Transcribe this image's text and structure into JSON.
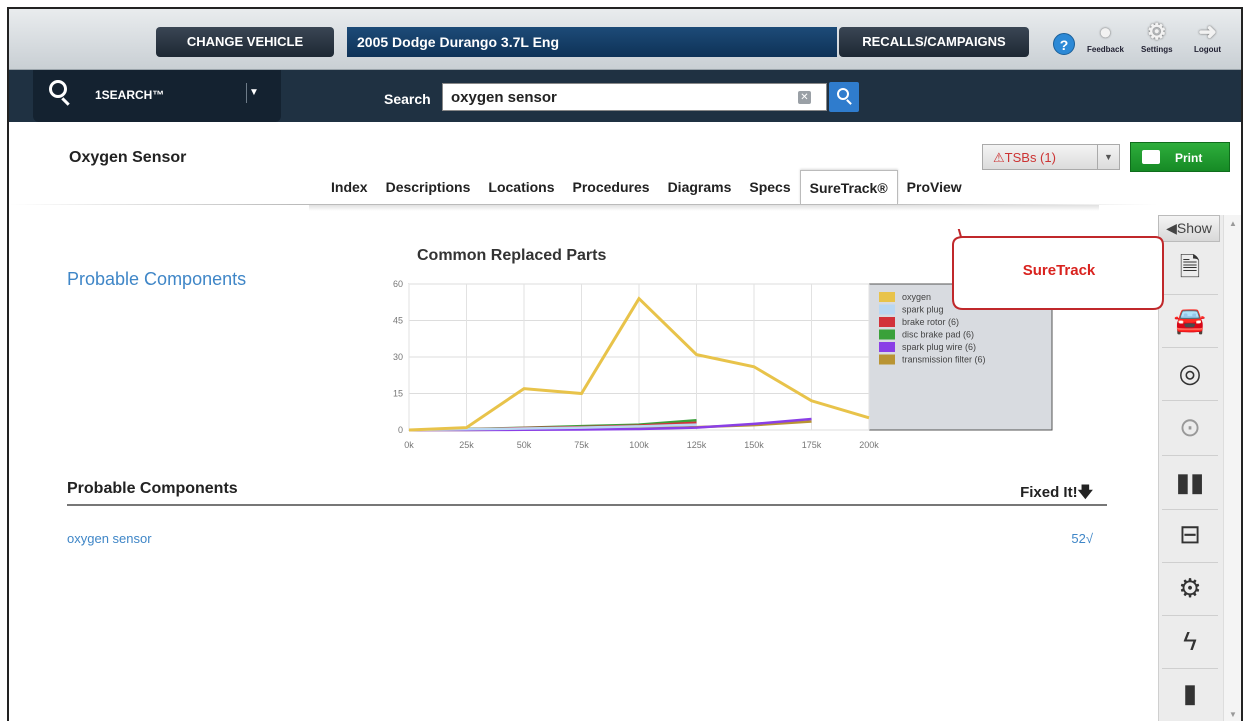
{
  "header": {
    "change_vehicle": "CHANGE VEHICLE",
    "vehicle": "2005 Dodge Durango 3.7L Eng",
    "recalls": "RECALLS/CAMPAIGNS",
    "help": "?",
    "feedback": "Feedback",
    "settings": "Settings",
    "logout": "Logout"
  },
  "search": {
    "brand": "1SEARCH™",
    "label": "Search",
    "value": "oxygen sensor",
    "clear": "✕"
  },
  "page": {
    "title": "Oxygen Sensor",
    "tsbs": "TSBs (1)",
    "print": "Print",
    "tabs": [
      "Index",
      "Descriptions",
      "Locations",
      "Procedures",
      "Diagrams",
      "Specs",
      "SureTrack®",
      "ProView"
    ],
    "active_tab": "SureTrack®",
    "probable_heading": "Probable Components"
  },
  "callout": {
    "text": "SureTrack",
    "color": "#d9231f"
  },
  "chart_data": {
    "type": "line",
    "title": "Common Replaced Parts",
    "x": [
      "0k",
      "25k",
      "50k",
      "75k",
      "100k",
      "125k",
      "150k",
      "175k",
      "200k"
    ],
    "ylim": [
      0,
      60
    ],
    "yticks": [
      0,
      15,
      30,
      45,
      60
    ],
    "legend_position": "right",
    "series": [
      {
        "name": "oxygen",
        "color": "#e8c34a",
        "values": [
          0,
          1,
          17,
          15,
          54,
          31,
          26,
          12,
          5
        ]
      },
      {
        "name": "spark plug",
        "color": "#b9d7f2",
        "values": [
          0,
          0.3,
          0.6,
          1,
          1.5,
          2.2,
          null,
          null,
          null
        ]
      },
      {
        "name": "brake rotor (6)",
        "color": "#d2323a",
        "values": [
          0,
          0.3,
          0.8,
          1.2,
          1.8,
          3,
          null,
          null,
          null
        ]
      },
      {
        "name": "disc brake pad (6)",
        "color": "#3aa13a",
        "values": [
          0,
          0.4,
          0.9,
          1.6,
          2.2,
          4,
          null,
          null,
          null
        ]
      },
      {
        "name": "spark plug wire (6)",
        "color": "#8a3fe6",
        "values": [
          0,
          0,
          0.1,
          0.2,
          0.4,
          1,
          2.5,
          4.5,
          null
        ]
      },
      {
        "name": "transmission filter (6)",
        "color": "#b99433",
        "values": [
          0,
          0,
          0.2,
          0.4,
          0.7,
          1.2,
          2,
          3.5,
          null
        ]
      }
    ]
  },
  "table": {
    "col1": "Probable Components",
    "col2": "Fixed It!",
    "rows": [
      {
        "name": "oxygen sensor",
        "count": "52√"
      }
    ]
  },
  "rail": {
    "show": "Show",
    "icons": [
      "info-doc-icon",
      "car-icon",
      "tire-icon",
      "tpms-icon",
      "manual-book-icon",
      "module-icon",
      "engine-icon",
      "electrical-icon",
      "notice-icon"
    ]
  }
}
